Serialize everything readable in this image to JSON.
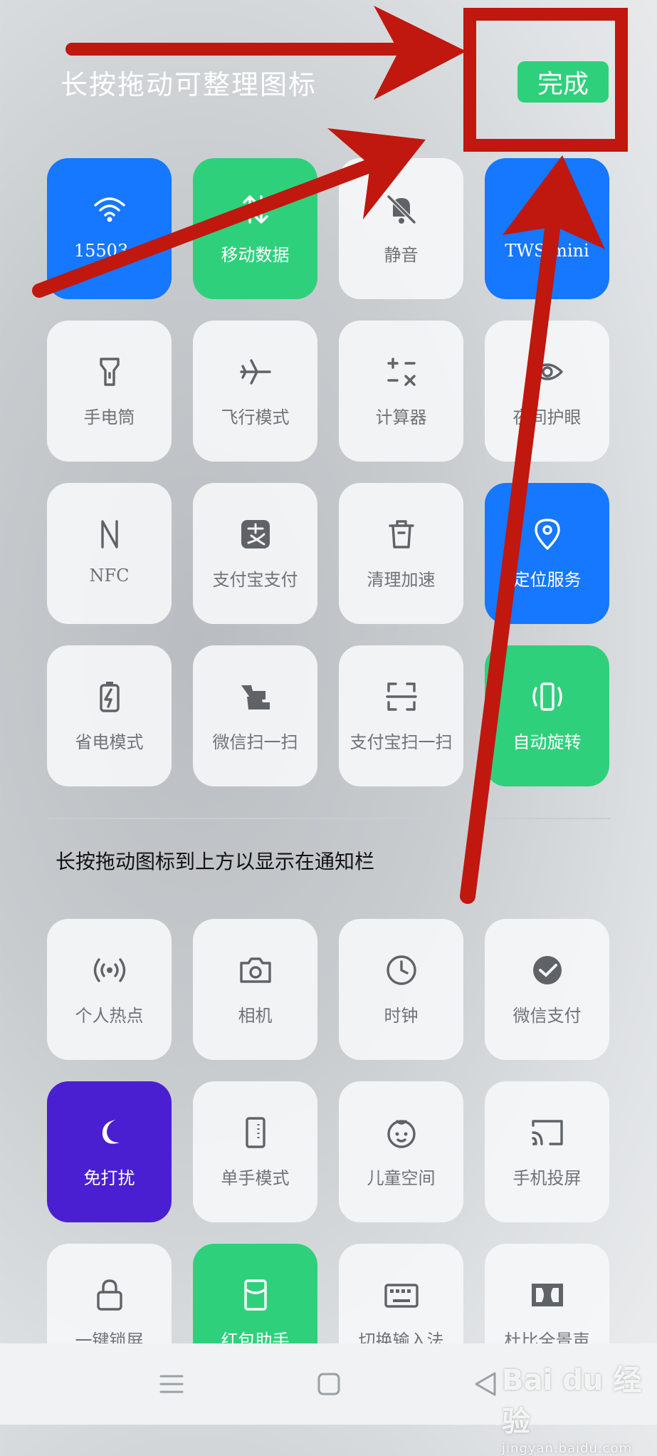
{
  "header": {
    "title": "长按拖动可整理图标",
    "done_label": "完成"
  },
  "active_tiles": [
    {
      "label": "15503...",
      "icon": "wifi-icon",
      "state": "on",
      "color": "#1677ff"
    },
    {
      "label": "移动数据",
      "icon": "mobile-data-icon",
      "state": "on",
      "color": "#2fd07c"
    },
    {
      "label": "静音",
      "icon": "bell-mute-icon",
      "state": "off"
    },
    {
      "label": "TWS mini",
      "icon": "bluetooth-icon",
      "state": "on",
      "color": "#1677ff"
    },
    {
      "label": "手电筒",
      "icon": "flashlight-icon",
      "state": "off"
    },
    {
      "label": "飞行模式",
      "icon": "airplane-icon",
      "state": "off"
    },
    {
      "label": "计算器",
      "icon": "calculator-icon",
      "state": "off"
    },
    {
      "label": "夜间护眼",
      "icon": "eye-icon",
      "state": "off"
    },
    {
      "label": "NFC",
      "icon": "nfc-icon",
      "state": "off"
    },
    {
      "label": "支付宝支付",
      "icon": "alipay-icon",
      "state": "off"
    },
    {
      "label": "清理加速",
      "icon": "trash-icon",
      "state": "off"
    },
    {
      "label": "定位服务",
      "icon": "location-icon",
      "state": "on",
      "color": "#1677ff"
    },
    {
      "label": "省电模式",
      "icon": "battery-icon",
      "state": "off"
    },
    {
      "label": "微信扫一扫",
      "icon": "wechat-scan-icon",
      "state": "off"
    },
    {
      "label": "支付宝扫一扫",
      "icon": "scan-icon",
      "state": "off"
    },
    {
      "label": "自动旋转",
      "icon": "rotate-icon",
      "state": "on",
      "color": "#2fd07c"
    }
  ],
  "section_title": "长按拖动图标到上方以显示在通知栏",
  "available_tiles": [
    {
      "label": "个人热点",
      "icon": "hotspot-icon",
      "state": "off"
    },
    {
      "label": "相机",
      "icon": "camera-icon",
      "state": "off"
    },
    {
      "label": "时钟",
      "icon": "clock-icon",
      "state": "off"
    },
    {
      "label": "微信支付",
      "icon": "wechat-pay-icon",
      "state": "off"
    },
    {
      "label": "免打扰",
      "icon": "moon-icon",
      "state": "on",
      "color": "#4a1fd1"
    },
    {
      "label": "单手模式",
      "icon": "one-hand-icon",
      "state": "off"
    },
    {
      "label": "儿童空间",
      "icon": "child-face-icon",
      "state": "off"
    },
    {
      "label": "手机投屏",
      "icon": "cast-icon",
      "state": "off"
    },
    {
      "label": "一键锁屏",
      "icon": "lock-icon",
      "state": "off"
    },
    {
      "label": "红包助手",
      "icon": "red-packet-icon",
      "state": "on",
      "color": "#2fd07c"
    },
    {
      "label": "切换输入法",
      "icon": "keyboard-icon",
      "state": "off"
    },
    {
      "label": "杜比全景声",
      "icon": "dolby-icon",
      "state": "off"
    }
  ],
  "navbar": {
    "icons": [
      "menu-icon",
      "home-icon",
      "back-icon"
    ]
  },
  "watermark": {
    "brand": "Bai du 经验",
    "url": "jingyan.baidu.com"
  },
  "colors": {
    "accent_blue": "#1677ff",
    "accent_green": "#2fd07c",
    "accent_purple": "#4a1fd1",
    "annotation_red": "#c0170f"
  }
}
